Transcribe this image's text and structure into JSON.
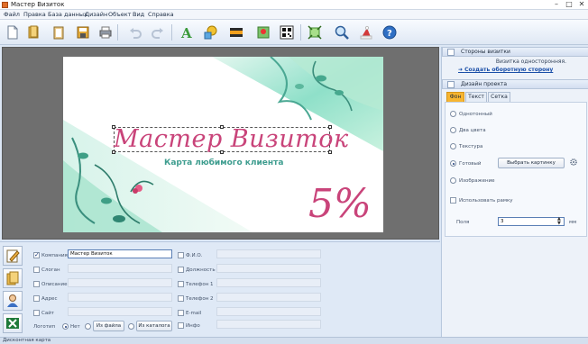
{
  "window": {
    "title": "Мастер Визиток"
  },
  "menu": [
    "Файл",
    "Правка",
    "База данных",
    "Дизайн",
    "Объект",
    "Вид",
    "Справка"
  ],
  "card": {
    "title": "Мастер Визиток",
    "subtitle": "Карта любимого клиента",
    "percent": "5%"
  },
  "fields": {
    "company": {
      "label": "Компания",
      "value": "Мастер Визиток",
      "checked": true
    },
    "slogan": {
      "label": "Слоган"
    },
    "description": {
      "label": "Описание"
    },
    "address": {
      "label": "Адрес"
    },
    "site": {
      "label": "Сайт"
    },
    "fio": {
      "label": "Ф.И.О."
    },
    "position": {
      "label": "Должность"
    },
    "phone1": {
      "label": "Телефон 1"
    },
    "phone2": {
      "label": "Телефон 2"
    },
    "email": {
      "label": "E-mail"
    },
    "info": {
      "label": "Инфо"
    }
  },
  "logo": {
    "label": "Логотип",
    "opt_none": "Нет",
    "opt_file": "Из файла",
    "opt_catalog": "Из каталога"
  },
  "sides": {
    "header": "Стороны визитки",
    "note": "Визитка односторонняя.",
    "link": "Создать оборотную сторону"
  },
  "design": {
    "header": "Дизайн проекта",
    "tabs": [
      "Фон",
      "Текст",
      "Сетка"
    ],
    "options": {
      "single": "Однотонный",
      "two": "Два цвета",
      "texture": "Текстура",
      "ready": "Готовый",
      "image": "Изображение"
    },
    "select_button": "Выбрать картинку",
    "frame": "Использовать рамку",
    "margin_label": "Поля",
    "margin_value": "3",
    "margin_unit": "мм"
  },
  "status": "Дисконтная карта",
  "colors": {
    "accent": "#c9447a",
    "teal": "#3e9d8f",
    "tab_active": "#f7b531"
  }
}
